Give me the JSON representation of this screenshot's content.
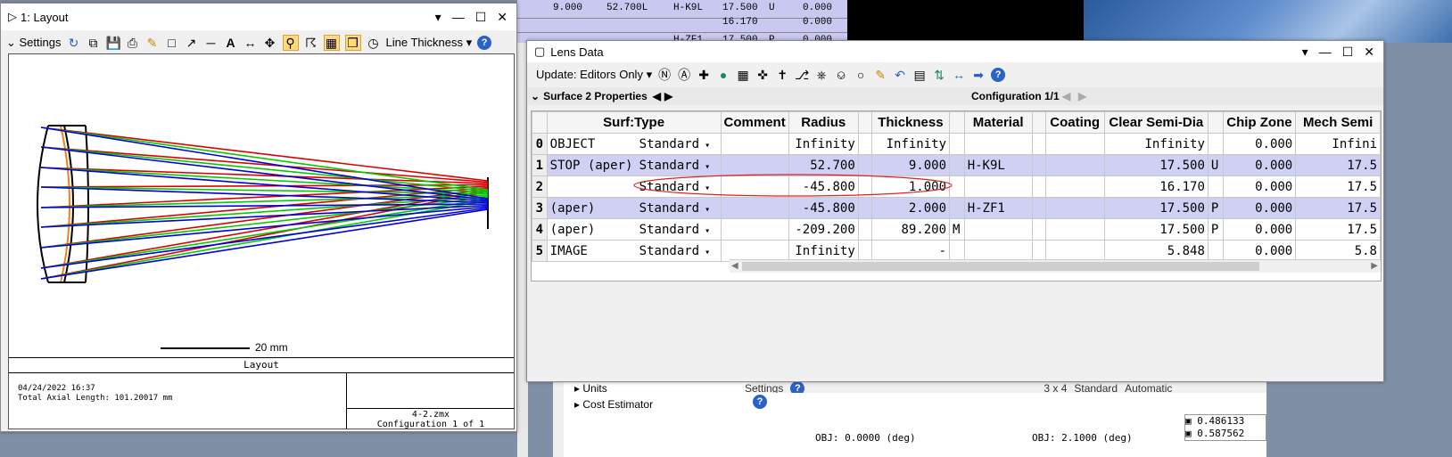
{
  "background": {
    "table_rows": [
      {
        "val1": "52.700L",
        "glass": "H-K9L",
        "sd": "17.500",
        "flag": "U",
        "chip": "0.000",
        "extra": "9.000"
      },
      {
        "val1": "",
        "glass": "",
        "sd": "16.170",
        "flag": "",
        "chip": "0.000",
        "extra": ""
      },
      {
        "val1": "",
        "glass": "H-ZF1",
        "sd": "17.500",
        "flag": "P",
        "chip": "0.000",
        "extra": ""
      }
    ],
    "lower_tree": [
      "Units",
      "Cost Estimator"
    ],
    "lower_toolbar_text": "Settings",
    "lower_toolbar_misc": [
      "3 x 4",
      "Standard",
      "Automatic"
    ],
    "wavelengths": [
      "0.486133",
      "0.587562"
    ],
    "obj_labels": [
      "OBJ: 0.0000 (deg)",
      "OBJ: 2.1000 (deg)"
    ]
  },
  "layout_window": {
    "title": "1: Layout",
    "settings_label": "Settings",
    "line_thickness_label": "Line Thickness",
    "scale_label": "20 mm",
    "caption": "Layout",
    "date": "04/24/2022 16:37",
    "axial_length": "Total Axial Length:  101.20017 mm",
    "file": "4-2.zmx",
    "config": "Configuration 1 of 1",
    "ray_colors": {
      "field1": "#0000dd",
      "field2": "#00cc00",
      "field3": "#dd0000",
      "lens": "#000000",
      "highlight": "#f08020"
    }
  },
  "lens_window": {
    "title": "Lens Data",
    "update_label": "Update: Editors Only",
    "surface_props": "Surface 2 Properties",
    "configuration": "Configuration 1/1",
    "columns": [
      "Surf:Type",
      "Comment",
      "Radius",
      "Thickness",
      "Material",
      "Coating",
      "Clear Semi-Dia",
      "Chip Zone",
      "Mech Semi"
    ],
    "rows": [
      {
        "num": "0",
        "name": "OBJECT",
        "type": "Standard",
        "comment": "",
        "radius": "Infinity",
        "rflag": "",
        "thickness": "Infinity",
        "tflag": "",
        "material": "",
        "mflag": "",
        "coating": "",
        "sd": "Infinity",
        "sdflag": "",
        "chip": "0.000",
        "mech": "Infini"
      },
      {
        "num": "1",
        "name": "STOP (aper)",
        "type": "Standard",
        "comment": "",
        "radius": "52.700",
        "rflag": "",
        "thickness": "9.000",
        "tflag": "",
        "material": "H-K9L",
        "mflag": "",
        "coating": "",
        "sd": "17.500",
        "sdflag": "U",
        "chip": "0.000",
        "mech": "17.5"
      },
      {
        "num": "2",
        "name": "",
        "type": "Standard",
        "comment": "",
        "radius": "-45.800",
        "rflag": "",
        "thickness": "1.000",
        "tflag": "",
        "material": "",
        "mflag": "",
        "coating": "",
        "sd": "16.170",
        "sdflag": "",
        "chip": "0.000",
        "mech": "17.5"
      },
      {
        "num": "3",
        "name": "(aper)",
        "type": "Standard",
        "comment": "",
        "radius": "-45.800",
        "rflag": "",
        "thickness": "2.000",
        "tflag": "",
        "material": "H-ZF1",
        "mflag": "",
        "coating": "",
        "sd": "17.500",
        "sdflag": "P",
        "chip": "0.000",
        "mech": "17.5"
      },
      {
        "num": "4",
        "name": "(aper)",
        "type": "Standard",
        "comment": "",
        "radius": "-209.200",
        "rflag": "",
        "thickness": "89.200",
        "tflag": "M",
        "material": "",
        "mflag": "",
        "coating": "",
        "sd": "17.500",
        "sdflag": "P",
        "chip": "0.000",
        "mech": "17.5"
      },
      {
        "num": "5",
        "name": "IMAGE",
        "type": "Standard",
        "comment": "",
        "radius": "Infinity",
        "rflag": "",
        "thickness": "-",
        "tflag": "",
        "material": "",
        "mflag": "",
        "coating": "",
        "sd": "5.848",
        "sdflag": "",
        "chip": "0.000",
        "mech": "5.8"
      }
    ],
    "annotation_color": "#e02020"
  }
}
